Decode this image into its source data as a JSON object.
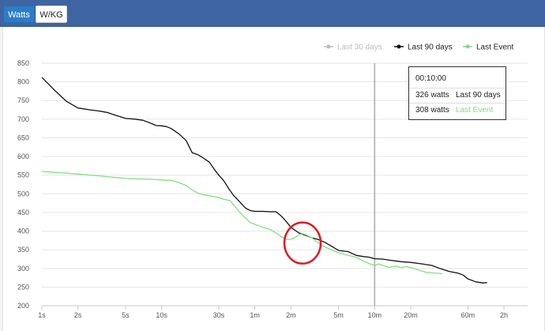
{
  "tabs": {
    "watts": "Watts",
    "wkg": "W/KG"
  },
  "colors": {
    "black": "#111111",
    "green": "#7fe07f",
    "gray": "#bbbbbb",
    "annotation": "#e0191f",
    "cursor": "#aaaaaa"
  },
  "legend": [
    {
      "label": "Last 30 days",
      "color": "#bbbbbb",
      "muted": true
    },
    {
      "label": "Last 90 days",
      "color": "#111111",
      "muted": false
    },
    {
      "label": "Last Event",
      "color": "#7fe07f",
      "muted": false
    }
  ],
  "tooltip": {
    "time": "00:10:00",
    "rows": [
      {
        "value": "326",
        "unit": "watts",
        "series": "Last 90 days",
        "color": "#222222"
      },
      {
        "value": "308",
        "unit": "watts",
        "series": "Last Event",
        "color": "#7fe07f"
      }
    ]
  },
  "chart_data": {
    "type": "line",
    "x_scale": "log",
    "x_unit": "seconds",
    "xlim": [
      1,
      7200
    ],
    "ylim": [
      200,
      850
    ],
    "yticks": [
      200,
      250,
      300,
      350,
      400,
      450,
      500,
      550,
      600,
      650,
      700,
      750,
      800,
      850
    ],
    "xticks": [
      {
        "label": "1s",
        "value": 1
      },
      {
        "label": "2s",
        "value": 2
      },
      {
        "label": "5s",
        "value": 5
      },
      {
        "label": "10s",
        "value": 10
      },
      {
        "label": "30s",
        "value": 30
      },
      {
        "label": "1m",
        "value": 60
      },
      {
        "label": "2m",
        "value": 120
      },
      {
        "label": "5m",
        "value": 300
      },
      {
        "label": "10m",
        "value": 600
      },
      {
        "label": "20m",
        "value": 1200
      },
      {
        "label": "60m",
        "value": 3600
      },
      {
        "label": "2h",
        "value": 7200
      }
    ],
    "cursor_x": 600,
    "annotation_circle_x": 150,
    "annotation_circle_y": 368,
    "series": [
      {
        "name": "Last 90 days",
        "color": "#111111",
        "points": [
          [
            1,
            812
          ],
          [
            1.3,
            775
          ],
          [
            1.6,
            748
          ],
          [
            2,
            730
          ],
          [
            2.5,
            725
          ],
          [
            3,
            722
          ],
          [
            3.5,
            718
          ],
          [
            4,
            712
          ],
          [
            5,
            702
          ],
          [
            6,
            700
          ],
          [
            7,
            697
          ],
          [
            8,
            690
          ],
          [
            9,
            683
          ],
          [
            10,
            682
          ],
          [
            11,
            680
          ],
          [
            12,
            675
          ],
          [
            14,
            660
          ],
          [
            16,
            643
          ],
          [
            18,
            610
          ],
          [
            20,
            605
          ],
          [
            22,
            597
          ],
          [
            25,
            585
          ],
          [
            28,
            562
          ],
          [
            30,
            550
          ],
          [
            33,
            535
          ],
          [
            37,
            510
          ],
          [
            40,
            495
          ],
          [
            45,
            478
          ],
          [
            50,
            462
          ],
          [
            55,
            455
          ],
          [
            60,
            453
          ],
          [
            70,
            453
          ],
          [
            80,
            452
          ],
          [
            90,
            452
          ],
          [
            100,
            440
          ],
          [
            110,
            425
          ],
          [
            120,
            410
          ],
          [
            140,
            395
          ],
          [
            160,
            388
          ],
          [
            180,
            382
          ],
          [
            200,
            378
          ],
          [
            230,
            370
          ],
          [
            260,
            360
          ],
          [
            300,
            348
          ],
          [
            360,
            345
          ],
          [
            420,
            335
          ],
          [
            480,
            332
          ],
          [
            540,
            330
          ],
          [
            600,
            326
          ],
          [
            700,
            325
          ],
          [
            800,
            322
          ],
          [
            900,
            320
          ],
          [
            1000,
            318
          ],
          [
            1200,
            316
          ],
          [
            1500,
            312
          ],
          [
            1800,
            308
          ],
          [
            2100,
            300
          ],
          [
            2500,
            292
          ],
          [
            3000,
            287
          ],
          [
            3300,
            282
          ],
          [
            3600,
            272
          ],
          [
            4200,
            264
          ],
          [
            4800,
            261
          ],
          [
            5200,
            262
          ]
        ]
      },
      {
        "name": "Last Event",
        "color": "#7fe07f",
        "points": [
          [
            1,
            560
          ],
          [
            1.5,
            556
          ],
          [
            2,
            553
          ],
          [
            3,
            548
          ],
          [
            4,
            544
          ],
          [
            5,
            541
          ],
          [
            6,
            540
          ],
          [
            8,
            539
          ],
          [
            10,
            537
          ],
          [
            12,
            536
          ],
          [
            14,
            530
          ],
          [
            16,
            522
          ],
          [
            18,
            510
          ],
          [
            20,
            502
          ],
          [
            22,
            498
          ],
          [
            25,
            495
          ],
          [
            28,
            492
          ],
          [
            30,
            490
          ],
          [
            33,
            485
          ],
          [
            37,
            482
          ],
          [
            40,
            470
          ],
          [
            45,
            450
          ],
          [
            50,
            435
          ],
          [
            55,
            423
          ],
          [
            60,
            418
          ],
          [
            70,
            410
          ],
          [
            80,
            405
          ],
          [
            90,
            395
          ],
          [
            100,
            385
          ],
          [
            110,
            378
          ],
          [
            120,
            378
          ],
          [
            130,
            383
          ],
          [
            140,
            390
          ],
          [
            150,
            393
          ],
          [
            160,
            390
          ],
          [
            180,
            382
          ],
          [
            200,
            370
          ],
          [
            230,
            358
          ],
          [
            260,
            350
          ],
          [
            300,
            342
          ],
          [
            360,
            335
          ],
          [
            420,
            330
          ],
          [
            480,
            320
          ],
          [
            540,
            313
          ],
          [
            600,
            308
          ],
          [
            650,
            312
          ],
          [
            700,
            308
          ],
          [
            800,
            303
          ],
          [
            900,
            306
          ],
          [
            1000,
            302
          ],
          [
            1100,
            305
          ],
          [
            1200,
            302
          ],
          [
            1400,
            296
          ],
          [
            1600,
            290
          ],
          [
            1800,
            288
          ],
          [
            2000,
            287
          ],
          [
            2200,
            286
          ]
        ]
      }
    ]
  }
}
